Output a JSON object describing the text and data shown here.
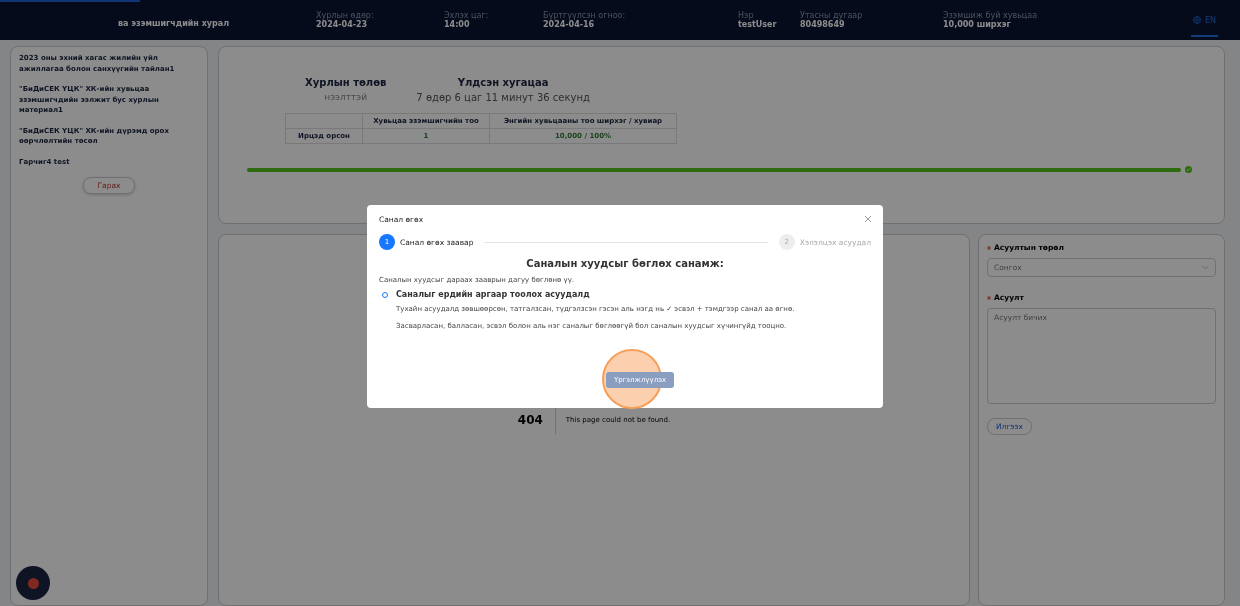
{
  "header": {
    "title": "ва эзэмшигчдийн хурал",
    "fields": [
      {
        "label": "Хурлын өдөр:",
        "value": "2024-04-23"
      },
      {
        "label": "Эхлэх цаг:",
        "value": "14:00"
      },
      {
        "label": "Бүртгүүлсэн огноо:",
        "value": "2024-04-16"
      },
      {
        "label": "Нэр",
        "value": "testUser"
      },
      {
        "label": "Утасны дугаар",
        "value": "80498649"
      },
      {
        "label": "Эзэмшиж буй хувьцаа",
        "value": "10,000 ширхэг"
      }
    ],
    "language": {
      "label": "EN",
      "selected": true
    }
  },
  "sidebar": {
    "items": [
      "2023 оны эхний хагас жилийн үйл ажиллагаа болон санхүүгийн тайлан1",
      "\"БиДиСЕК ҮЦК\" ХК-ийн хувьцаа эзэмшигчдийн ээлжит бус хурлын материал1",
      "\"БиДиСЕК ҮЦК\" ХК-ийн дүрэмд орох өөрчлөлтийн төсөл",
      "Гарчиг4 test"
    ],
    "button": "Гарах"
  },
  "meeting": {
    "status_label": "Хурлын төлөв",
    "status_value": "нээлттэй",
    "remaining_label": "Үлдсэн хугацаа",
    "remaining_value": "7 өдөр 6 цаг 11 минут 36 секунд",
    "table": {
      "columns": [
        "Хувьцаа эзэмшигчийн тоо",
        "Энгийн хувьцааны тоо ширхэг / хувиар"
      ],
      "rows": [
        {
          "label": "Ирцэд орсон",
          "cells": [
            "1",
            "10,000 / 100%"
          ]
        }
      ]
    },
    "progress": {
      "level": 1
    }
  },
  "not_found": {
    "code": "404",
    "message": "This page could not be found."
  },
  "question_form": {
    "fields": [
      {
        "kind": "select",
        "label": "Асуултын төрөл",
        "placeholder": "Сонгох",
        "required": true
      },
      {
        "kind": "textarea",
        "label": "Асуулт",
        "placeholder": "Асуулт бичих",
        "required": true
      }
    ],
    "button": "Илгээх"
  },
  "modal": {
    "title": "Санал өгөх",
    "steps": [
      {
        "number": "1",
        "label": "Санал өгөх заавар",
        "selected": true
      },
      {
        "number": "2",
        "label": "Хэлэлцэх асуудал",
        "selected": false
      }
    ],
    "heading": "Саналын хуудсыг бөглөх санамж:",
    "intro": "Саналын хуудсыг дараах зааврын дагуу бөглөнө үү.",
    "bullet": "Саналыг ердийн аргаар тоолох асуудалд",
    "paragraphs": [
      "Тухайн асуудалд зөвшөөрсөн, татгалзсан, түдгэлзсэн гэсэн аль нэгд нь ✓ эсвэл + тэмдгээр санал аа өгнө.",
      "Засварласан, балласан, эсвэл болон аль нэг саналыг бөглөөгүй бол саналын хуудсыг хүчингүйд тооцно."
    ],
    "button": "Үргэлжлүүлэх"
  }
}
